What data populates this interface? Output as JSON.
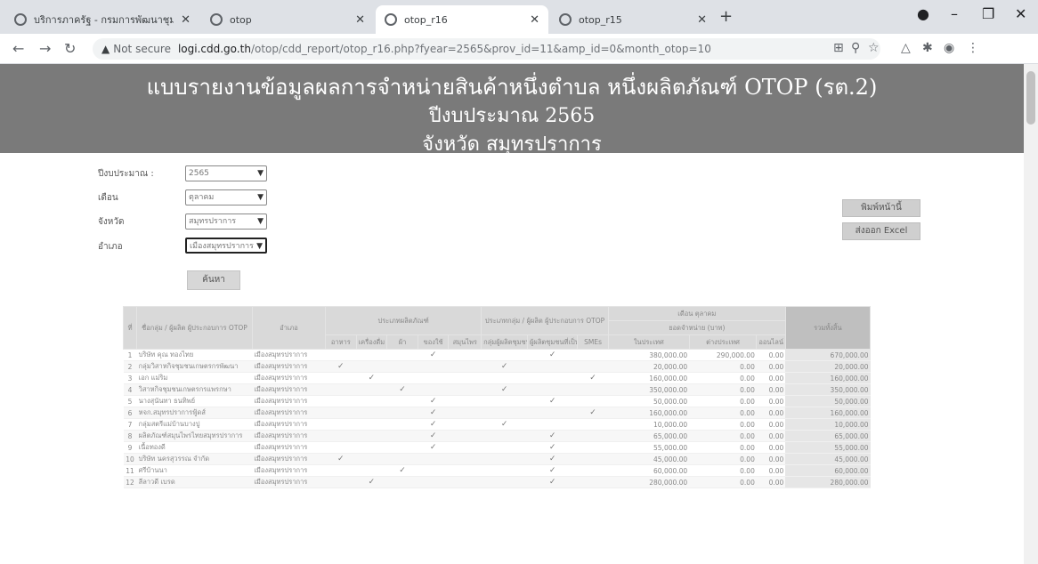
{
  "browser": {
    "tabs": [
      {
        "title": "บริการภาครัฐ - กรมการพัฒนาชุมชน",
        "active": false
      },
      {
        "title": "otop",
        "active": false
      },
      {
        "title": "otop_r16",
        "active": true
      },
      {
        "title": "otop_r15",
        "active": false
      }
    ],
    "address": {
      "not_secure": "Not secure",
      "host": "logi.cdd.go.th",
      "path": "/otop/cdd_report/otop_r16.php?fyear=2565&prov_id=11&amp_id=0&month_otop=10"
    }
  },
  "banner": {
    "line1": "แบบรายงานข้อมูลผลการจำหน่ายสินค้าหนึ่งตำบล หนึ่งผลิตภัณฑ์ OTOP (รต.2)",
    "line2": "ปีงบประมาณ 2565",
    "line3": "จังหวัด สมุทรปราการ"
  },
  "filters": [
    {
      "label": "ปีงบประมาณ :",
      "value": "2565"
    },
    {
      "label": "เดือน",
      "value": "ตุลาคม"
    },
    {
      "label": "จังหวัด",
      "value": "สมุทรปราการ"
    },
    {
      "label": "อำเภอ",
      "value": "เมืองสมุทรปราการ"
    }
  ],
  "search_label": "ค้นหา",
  "print_label": "พิมพ์หน้านี้",
  "export_label": "ส่งออก Excel",
  "table": {
    "headers": {
      "no": "ที่",
      "name": "ชื่อกลุ่ม / ผู้ผลิต ผู้ประกอบการ OTOP",
      "district": "อำเภอ",
      "type_group": "ประเภทผลิตภัณฑ์",
      "types": [
        "อาหาร",
        "เครื่องดื่ม",
        "ผ้า",
        "ของใช้",
        "สมุนไพร"
      ],
      "prod_group": "ประเภทกลุ่ม / ผู้ผลิต ผู้ประกอบการ OTOP",
      "prods": [
        "กลุ่มผู้ผลิตชุมชน",
        "ผู้ผลิตชุมชนที่เป็นเจ้าของรายเดียว",
        "SMEs"
      ],
      "sales_group": "เดือน ตุลาคม",
      "sales_sub": "ยอดจำหน่าย (บาท)",
      "sales": [
        "ในประเทศ",
        "ต่างประเทศ",
        "ออนไลน์"
      ],
      "total": "รวมทั้งสิ้น"
    },
    "rows": [
      {
        "no": "1",
        "name": "บริษัท คุณ ทองไทย",
        "district": "เมืองสมุทรปราการ",
        "t": [
          0,
          0,
          0,
          1,
          0
        ],
        "p": [
          0,
          1,
          0
        ],
        "d": "380,000.00",
        "f": "290,000.00",
        "o": "0.00",
        "total": "670,000.00"
      },
      {
        "no": "2",
        "name": "กลุ่มวิสาหกิจชุมชนเกษตรกรพัฒนา",
        "district": "เมืองสมุทรปราการ",
        "t": [
          1,
          0,
          0,
          0,
          0
        ],
        "p": [
          1,
          0,
          0
        ],
        "d": "20,000.00",
        "f": "0.00",
        "o": "0.00",
        "total": "20,000.00"
      },
      {
        "no": "3",
        "name": "เอก แม่ริม",
        "district": "เมืองสมุทรปราการ",
        "t": [
          0,
          1,
          0,
          0,
          0
        ],
        "p": [
          0,
          0,
          1
        ],
        "d": "160,000.00",
        "f": "0.00",
        "o": "0.00",
        "total": "160,000.00"
      },
      {
        "no": "4",
        "name": "วิสาหกิจชุมชนเกษตรกรแพรกษา",
        "district": "เมืองสมุทรปราการ",
        "t": [
          0,
          0,
          1,
          0,
          0
        ],
        "p": [
          1,
          0,
          0
        ],
        "d": "350,000.00",
        "f": "0.00",
        "o": "0.00",
        "total": "350,000.00"
      },
      {
        "no": "5",
        "name": "นางสุนันทา ธนทิพย์",
        "district": "เมืองสมุทรปราการ",
        "t": [
          0,
          0,
          0,
          1,
          0
        ],
        "p": [
          0,
          1,
          0
        ],
        "d": "50,000.00",
        "f": "0.00",
        "o": "0.00",
        "total": "50,000.00"
      },
      {
        "no": "6",
        "name": "หจก.สมุทรปราการฟู้ดส์",
        "district": "เมืองสมุทรปราการ",
        "t": [
          0,
          0,
          0,
          1,
          0
        ],
        "p": [
          0,
          0,
          1
        ],
        "d": "160,000.00",
        "f": "0.00",
        "o": "0.00",
        "total": "160,000.00"
      },
      {
        "no": "7",
        "name": "กลุ่มสตรีแม่บ้านบางปู",
        "district": "เมืองสมุทรปราการ",
        "t": [
          0,
          0,
          0,
          1,
          0
        ],
        "p": [
          1,
          0,
          0
        ],
        "d": "10,000.00",
        "f": "0.00",
        "o": "0.00",
        "total": "10,000.00"
      },
      {
        "no": "8",
        "name": "ผลิตภัณฑ์สมุนไพรไทยสมุทรปราการ",
        "district": "เมืองสมุทรปราการ",
        "t": [
          0,
          0,
          0,
          1,
          0
        ],
        "p": [
          0,
          1,
          0
        ],
        "d": "65,000.00",
        "f": "0.00",
        "o": "0.00",
        "total": "65,000.00"
      },
      {
        "no": "9",
        "name": "เนื้อทองดี",
        "district": "เมืองสมุทรปราการ",
        "t": [
          0,
          0,
          0,
          1,
          0
        ],
        "p": [
          0,
          1,
          0
        ],
        "d": "55,000.00",
        "f": "0.00",
        "o": "0.00",
        "total": "55,000.00"
      },
      {
        "no": "10",
        "name": "บริษัท นครสุวรรณ จำกัด",
        "district": "เมืองสมุทรปราการ",
        "t": [
          1,
          0,
          0,
          0,
          0
        ],
        "p": [
          0,
          1,
          0
        ],
        "d": "45,000.00",
        "f": "0.00",
        "o": "0.00",
        "total": "45,000.00"
      },
      {
        "no": "11",
        "name": "ศรีบ้านนา",
        "district": "เมืองสมุทรปราการ",
        "t": [
          0,
          0,
          1,
          0,
          0
        ],
        "p": [
          0,
          1,
          0
        ],
        "d": "60,000.00",
        "f": "0.00",
        "o": "0.00",
        "total": "60,000.00"
      },
      {
        "no": "12",
        "name": "ลีลาวดี เบรด",
        "district": "เมืองสมุทรปราการ",
        "t": [
          0,
          1,
          0,
          0,
          0
        ],
        "p": [
          0,
          1,
          0
        ],
        "d": "280,000.00",
        "f": "0.00",
        "o": "0.00",
        "total": "280,000.00"
      }
    ]
  }
}
